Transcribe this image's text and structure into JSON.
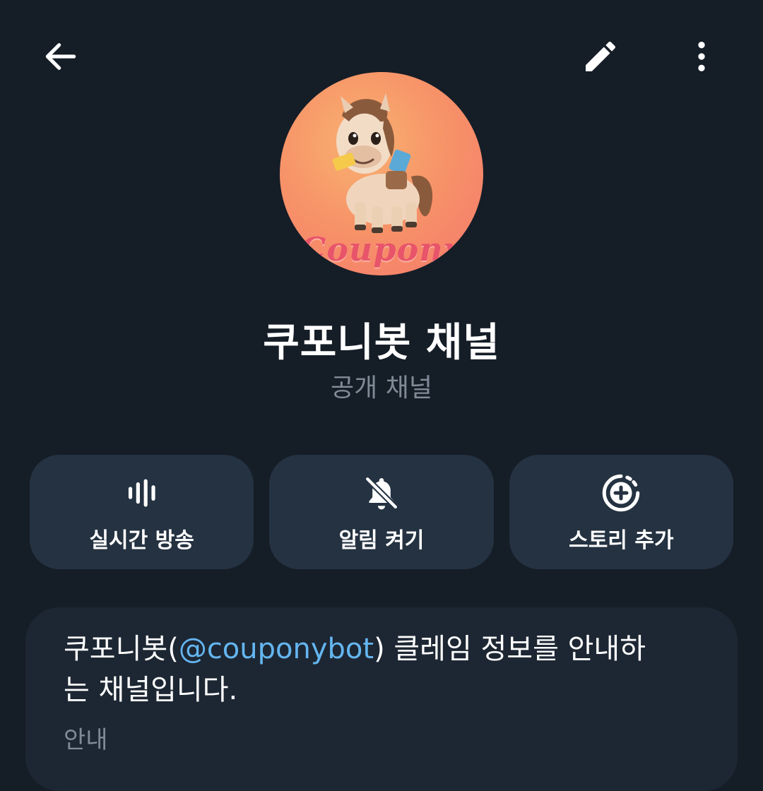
{
  "header": {
    "back_icon": "arrow-left-icon",
    "edit_icon": "pencil-icon",
    "more_icon": "more-vertical-icon"
  },
  "profile": {
    "avatar_brand": "Coupony",
    "name": "쿠포니봇 채널",
    "type": "공개 채널"
  },
  "actions": [
    {
      "label": "실시간 방송",
      "icon": "live-stream-icon"
    },
    {
      "label": "알림 켜기",
      "icon": "bell-off-icon"
    },
    {
      "label": "스토리 추가",
      "icon": "add-story-icon"
    }
  ],
  "info": {
    "desc_prefix": "쿠포니봇(",
    "mention": "@couponybot",
    "desc_suffix": ") 클레임 정보를 안내하는 채널입니다.",
    "label": "안내"
  },
  "colors": {
    "background": "#151d27",
    "card": "#243241",
    "link": "#64b6f0",
    "muted": "#7f8b97"
  }
}
